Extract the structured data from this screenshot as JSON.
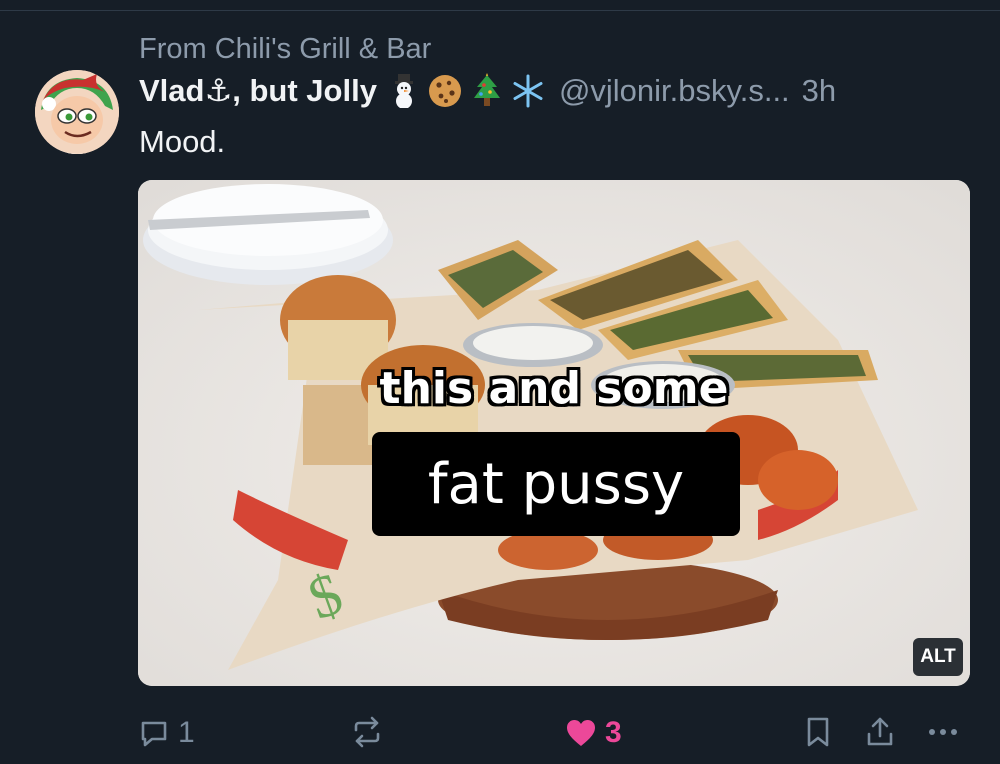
{
  "post": {
    "context_label": "From Chili's Grill & Bar",
    "display_name": "Vlad⚓, but Jolly",
    "name_emojis": [
      "snowman-icon",
      "cookie-icon",
      "christmas-tree-icon",
      "snowflake-icon"
    ],
    "handle": "@vjlonir.bsky.s...",
    "time": "3h",
    "text": "Mood."
  },
  "media": {
    "caption_top": "this and some",
    "caption_bottom": "fat pussy",
    "alt_label": "ALT"
  },
  "actions": {
    "reply_count": "1",
    "repost_count": "",
    "like_count": "3"
  },
  "colors": {
    "background": "#161e27",
    "muted_text": "#8d9bab",
    "like_accent": "#ec4899"
  }
}
